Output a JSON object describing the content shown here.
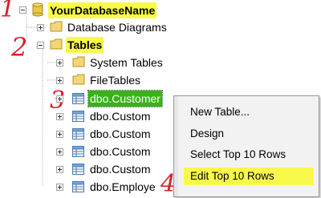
{
  "annotations": [
    "1",
    "2",
    "3",
    "4"
  ],
  "tree": {
    "database": "YourDatabaseName",
    "database_diagrams": "Database Diagrams",
    "tables": "Tables",
    "system_tables": "System Tables",
    "file_tables": "FileTables",
    "table_rows": [
      "dbo.Customer",
      "dbo.Custom",
      "dbo.Custom",
      "dbo.Custom",
      "dbo.Custom",
      "dbo.Employe"
    ]
  },
  "context_menu": {
    "items": [
      "New Table...",
      "Design",
      "Select Top 10 Rows",
      "Edit Top 10 Rows"
    ]
  },
  "colors": {
    "highlight": "#f9f94b",
    "selected": "#38b21a",
    "annotation": "#d8202a"
  }
}
